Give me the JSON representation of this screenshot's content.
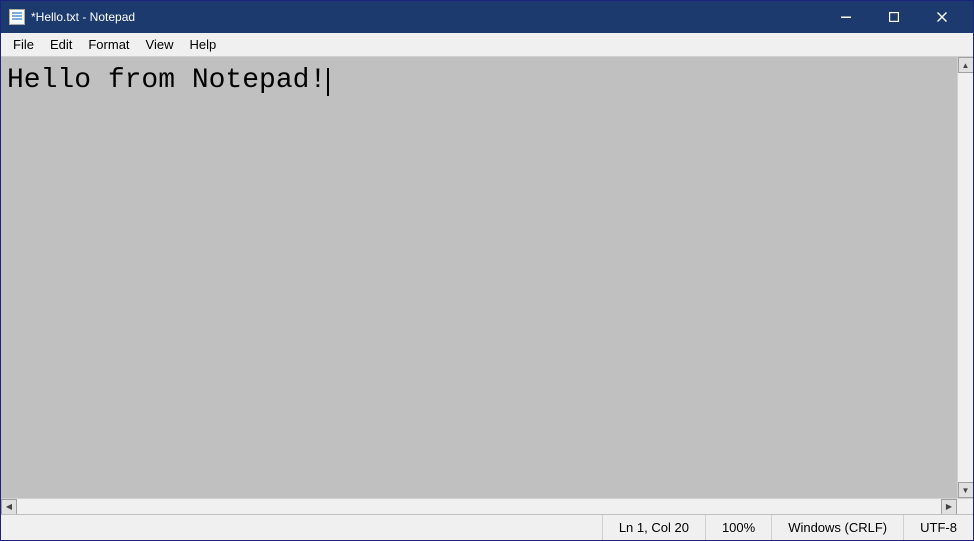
{
  "window": {
    "title": "*Hello.txt - Notepad",
    "icon": "notepad-icon"
  },
  "titlebar": {
    "minimize_label": "minimize",
    "maximize_label": "maximize",
    "close_label": "close"
  },
  "menubar": {
    "items": [
      {
        "id": "file",
        "label": "File"
      },
      {
        "id": "edit",
        "label": "Edit"
      },
      {
        "id": "format",
        "label": "Format"
      },
      {
        "id": "view",
        "label": "View"
      },
      {
        "id": "help",
        "label": "Help"
      }
    ]
  },
  "editor": {
    "content": "Hello from Notepad!"
  },
  "statusbar": {
    "position": "Ln 1, Col 20",
    "zoom": "100%",
    "line_ending": "Windows (CRLF)",
    "encoding": "UTF-8"
  }
}
